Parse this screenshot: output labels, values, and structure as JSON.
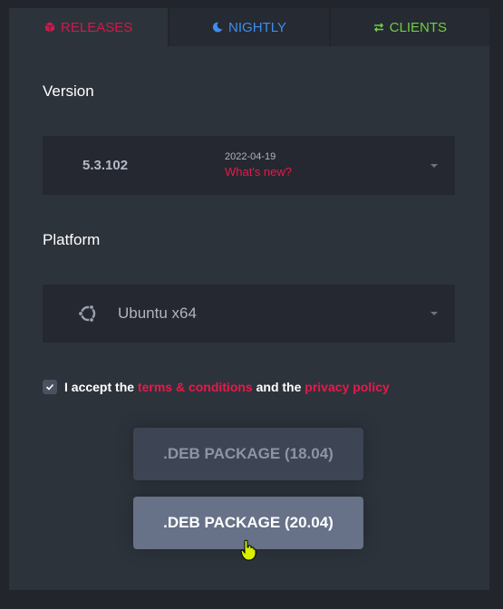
{
  "tabs": [
    {
      "label": "RELEASES",
      "icon": "cube-icon",
      "color": "#d0194b",
      "active": true
    },
    {
      "label": "NIGHTLY",
      "icon": "moon-icon",
      "color": "#3d8ef0",
      "active": false
    },
    {
      "label": "CLIENTS",
      "icon": "arrows-exchange-icon",
      "color": "#6fcf3f",
      "active": false
    }
  ],
  "version": {
    "label": "Version",
    "value": "5.3.102",
    "date": "2022-04-19",
    "whats_new": "What's new?"
  },
  "platform": {
    "label": "Platform",
    "value": "Ubuntu x64",
    "icon": "ubuntu-icon"
  },
  "accept": {
    "checked": true,
    "prefix": "I accept the",
    "terms": "terms & conditions",
    "middle": "and the",
    "privacy": "privacy policy"
  },
  "buttons": [
    ".DEB PACKAGE (18.04)",
    ".DEB PACKAGE (20.04)"
  ],
  "colors": {
    "accent": "#e8194b",
    "background": "#22252c",
    "panel": "#2d333b"
  }
}
